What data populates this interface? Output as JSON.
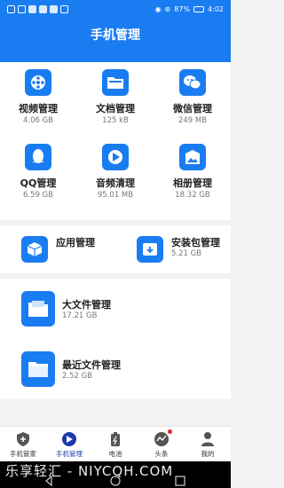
{
  "status_bar": {
    "battery": "87%",
    "time": "4:02"
  },
  "header": {
    "title": "手机管理"
  },
  "grid": [
    {
      "name": "视频管理",
      "size": "4.06 GB",
      "icon": "film-reel-icon"
    },
    {
      "name": "文档管理",
      "size": "125 kB",
      "icon": "folder-icon"
    },
    {
      "name": "微信管理",
      "size": "249 MB",
      "icon": "wechat-icon"
    },
    {
      "name": "QQ管理",
      "size": "6.59 GB",
      "icon": "qq-penguin-icon"
    },
    {
      "name": "音频清理",
      "size": "95.01 MB",
      "icon": "audio-icon"
    },
    {
      "name": "相册管理",
      "size": "18.32 GB",
      "icon": "photo-album-icon"
    }
  ],
  "apps": [
    {
      "name": "应用管理",
      "size": "",
      "icon": "cube-icon"
    },
    {
      "name": "安装包管理",
      "size": "5.21 GB",
      "icon": "package-download-icon"
    }
  ],
  "files": [
    {
      "name": "大文件管理",
      "size": "17.21 GB",
      "icon": "large-file-folder-icon"
    },
    {
      "name": "最近文件管理",
      "size": "2.52 GB",
      "icon": "recent-folder-icon"
    }
  ],
  "bottom_nav": [
    {
      "label": "手机管家",
      "icon": "shield-plus-icon"
    },
    {
      "label": "手机管理",
      "icon": "manage-icon",
      "active": true
    },
    {
      "label": "电池",
      "icon": "battery-icon"
    },
    {
      "label": "头条",
      "icon": "headlines-icon",
      "badge": true
    },
    {
      "label": "我的",
      "icon": "profile-icon"
    }
  ],
  "watermark": {
    "text": "乐享轻汇 - NIYCQH.COM"
  },
  "colors": {
    "primary": "#1a7cf1",
    "background": "#f2f2f2",
    "badge": "#e02525"
  }
}
